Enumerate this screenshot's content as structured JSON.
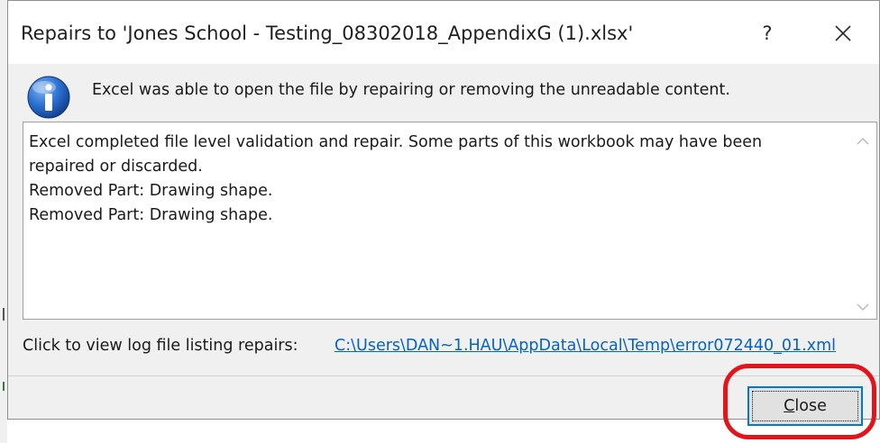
{
  "dialog": {
    "title": "Repairs to 'Jones School - Testing_08302018_AppendixG (1).xlsx'",
    "help_label": "?",
    "message": "Excel was able to open the file by repairing or removing the unreadable content.",
    "details_text": "Excel completed file level validation and repair. Some parts of this workbook may have been\nrepaired or discarded.\nRemoved Part: Drawing shape.\nRemoved Part: Drawing shape.",
    "log_label": "Click to view log file listing repairs:",
    "log_link": "C:\\Users\\DAN~1.HAU\\AppData\\Local\\Temp\\error072440_01.xml",
    "close_button": {
      "mnemonic": "C",
      "rest": "lose"
    }
  },
  "icons": {
    "info": "info-icon",
    "close": "close-icon",
    "scroll_up": "chevron-up-icon",
    "scroll_down": "chevron-down-icon"
  },
  "colors": {
    "link": "#0563c1",
    "focus_border": "#0078d7",
    "highlight": "#e3141c",
    "info_icon": "#1e5fb4"
  }
}
